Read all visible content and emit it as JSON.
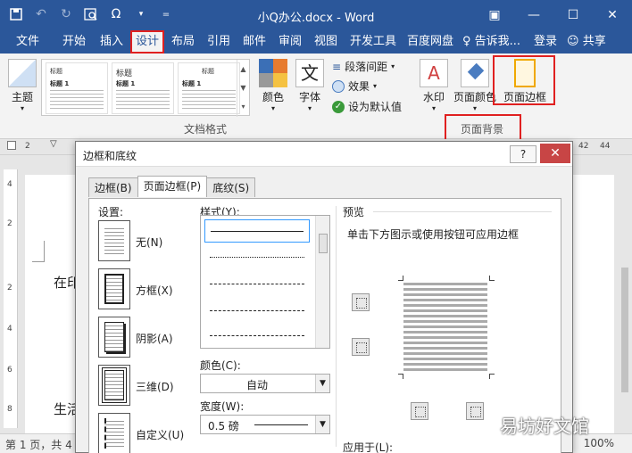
{
  "titlebar": {
    "title": "小Q办公.docx - Word",
    "qat": [
      "save-icon",
      "undo-icon",
      "redo-icon",
      "print-preview-icon",
      "omega-symbol-icon",
      "customize-icon"
    ],
    "omega": "Ω",
    "window_controls": [
      "restore-icon",
      "minimize-icon",
      "maximize-icon",
      "close-icon"
    ]
  },
  "tabs": {
    "file": "文件",
    "home": "开始",
    "insert": "插入",
    "design": "设计",
    "layout": "布局",
    "references": "引用",
    "mailings": "邮件",
    "review": "审阅",
    "view": "视图",
    "developer": "开发工具",
    "baidu": "百度网盘",
    "tellme": "♀ 告诉我...",
    "login": "登录",
    "share": "共享"
  },
  "ribbon": {
    "theme_label": "主题",
    "gallery": {
      "thumb1_title": "标题",
      "thumb1_heading": "标题 1",
      "thumb2_title": "标题",
      "thumb2_heading": "标题 1",
      "thumb3_title": "标题",
      "thumb3_heading": "标题 1"
    },
    "colors_label": "颜色",
    "fonts_label": "字体",
    "fonts_glyph": "文",
    "paragraph_spacing": "段落间距",
    "effects": "效果",
    "set_default": "设为默认值",
    "group_document_format": "文档格式",
    "watermark_label": "水印",
    "page_color_label": "页面颜色",
    "page_borders_label": "页面边框",
    "group_page_background": "页面背景",
    "accent_color": "#e02020"
  },
  "ruler": {
    "left": "2",
    "mid": "2",
    "r1": "42",
    "r2": "44"
  },
  "vruler": [
    "4",
    "2",
    "2",
    "4",
    "6",
    "8"
  ],
  "document": {
    "line1": "在印",
    "line2": "生活"
  },
  "status": {
    "left": "第 1 页，共 4",
    "zoom": "100%"
  },
  "dialog": {
    "title": "边框和底纹",
    "help": "?",
    "close": "✕",
    "tabs": [
      "边框(B)",
      "页面边框(P)",
      "底纹(S)"
    ],
    "settings_label": "设置:",
    "settings": [
      "无(N)",
      "方框(X)",
      "阴影(A)",
      "三维(D)",
      "自定义(U)"
    ],
    "style_label": "样式(Y):",
    "color_label": "颜色(C):",
    "color_value": "自动",
    "width_label": "宽度(W):",
    "width_value": "0.5 磅",
    "preview_label": "预览",
    "preview_desc": "单击下方图示或使用按钮可应用边框",
    "apply_to_label": "应用于(L):"
  },
  "watermark_text": "易坊好文馆"
}
